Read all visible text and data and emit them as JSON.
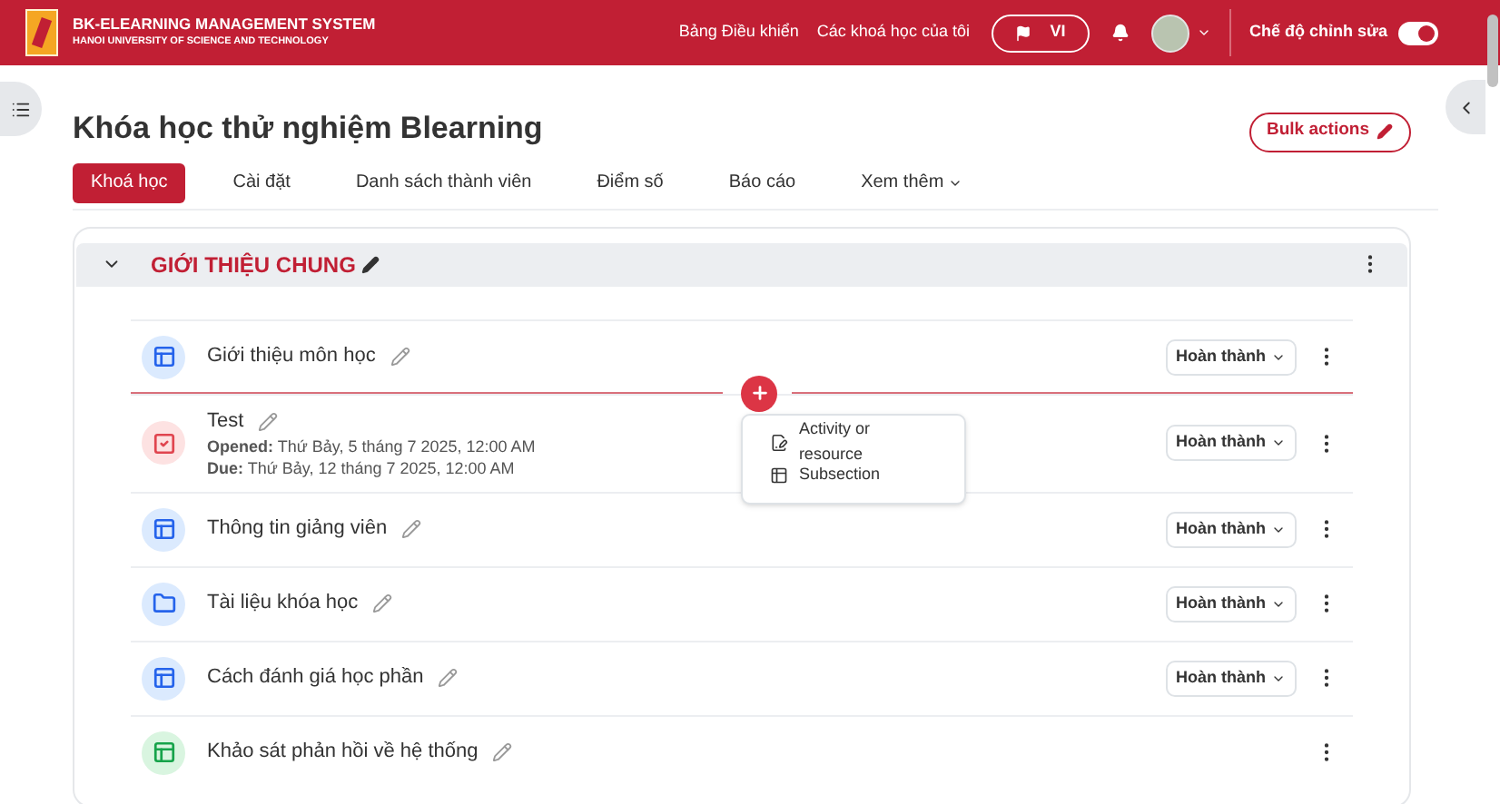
{
  "header": {
    "brand_title": "BK-ELEARNING MANAGEMENT SYSTEM",
    "brand_subtitle": "HANOI UNIVERSITY OF SCIENCE AND TECHNOLOGY",
    "links": [
      "Bảng Điều khiển",
      "Các khoá học của tôi"
    ],
    "language": "VI",
    "edit_mode": {
      "label": "Chế độ chỉnh sửa",
      "on": true
    }
  },
  "course": {
    "title": "Khóa học thử nghiệm Blearning",
    "bulk_actions": "Bulk actions"
  },
  "tabs": [
    {
      "label": "Khoá học",
      "selected": true
    },
    {
      "label": "Cài đặt",
      "selected": false
    },
    {
      "label": "Danh sách thành viên",
      "selected": false
    },
    {
      "label": "Điểm số",
      "selected": false
    },
    {
      "label": "Báo cáo",
      "selected": false
    },
    {
      "label": "Xem thêm",
      "selected": false,
      "kind": "more"
    }
  ],
  "section": {
    "title": "GIỚI THIỆU CHUNG",
    "expanded": true
  },
  "activities": [
    {
      "kind": "page",
      "name": "Giới thiệu môn học",
      "completion": "Hoàn thành"
    },
    {
      "kind": "quiz",
      "name": "Test",
      "dates": [
        "**Opened:** Thứ Bảy, 5 tháng 7 2025, 12:00 AM",
        "**Due:** Thứ Bảy, 12 tháng 7 2025, 12:00 AM"
      ],
      "completion": "Hoàn thành"
    },
    {
      "kind": "page",
      "name": "Thông tin giảng viên",
      "completion": "Hoàn thành"
    },
    {
      "kind": "folder",
      "name": "Tài liệu khóa học",
      "completion": "Hoàn thành"
    },
    {
      "kind": "page",
      "name": "Cách đánh giá học phần",
      "completion": "Hoàn thành"
    },
    {
      "kind": "feedback",
      "name": "Khảo sát phản hồi về hệ thống"
    }
  ],
  "add_menu": {
    "items": [
      {
        "kind": "activity",
        "label": "Activity or resource"
      },
      {
        "kind": "subsection",
        "label": "Subsection"
      }
    ]
  }
}
